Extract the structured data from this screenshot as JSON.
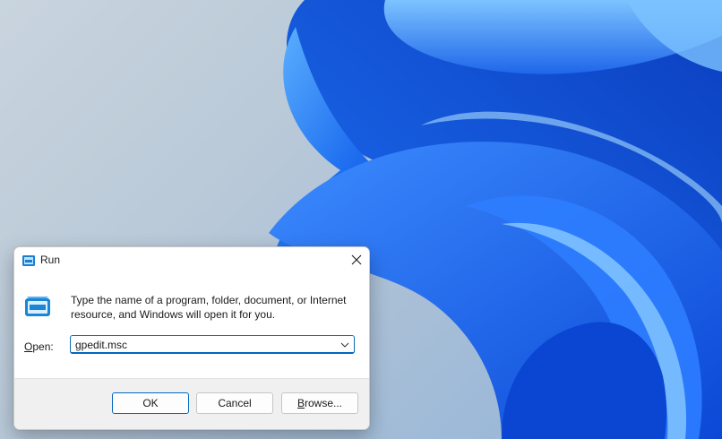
{
  "desktop": {
    "wallpaper": "windows-11-bloom",
    "accent_colors": [
      "#0a4fd8",
      "#1a74f0",
      "#4aa3ff",
      "#9fd0ff"
    ]
  },
  "run_dialog": {
    "title": "Run",
    "title_icon": "run-icon",
    "close_icon": "close-icon",
    "description": "Type the name of a program, folder, document, or Internet resource, and Windows will open it for you.",
    "open_label_prefix": "",
    "open_label_underlined": "O",
    "open_label_rest": "pen:",
    "open_value": "gpedit.msc",
    "buttons": {
      "ok": "OK",
      "cancel": "Cancel",
      "browse_underlined": "B",
      "browse_rest": "rowse..."
    }
  }
}
